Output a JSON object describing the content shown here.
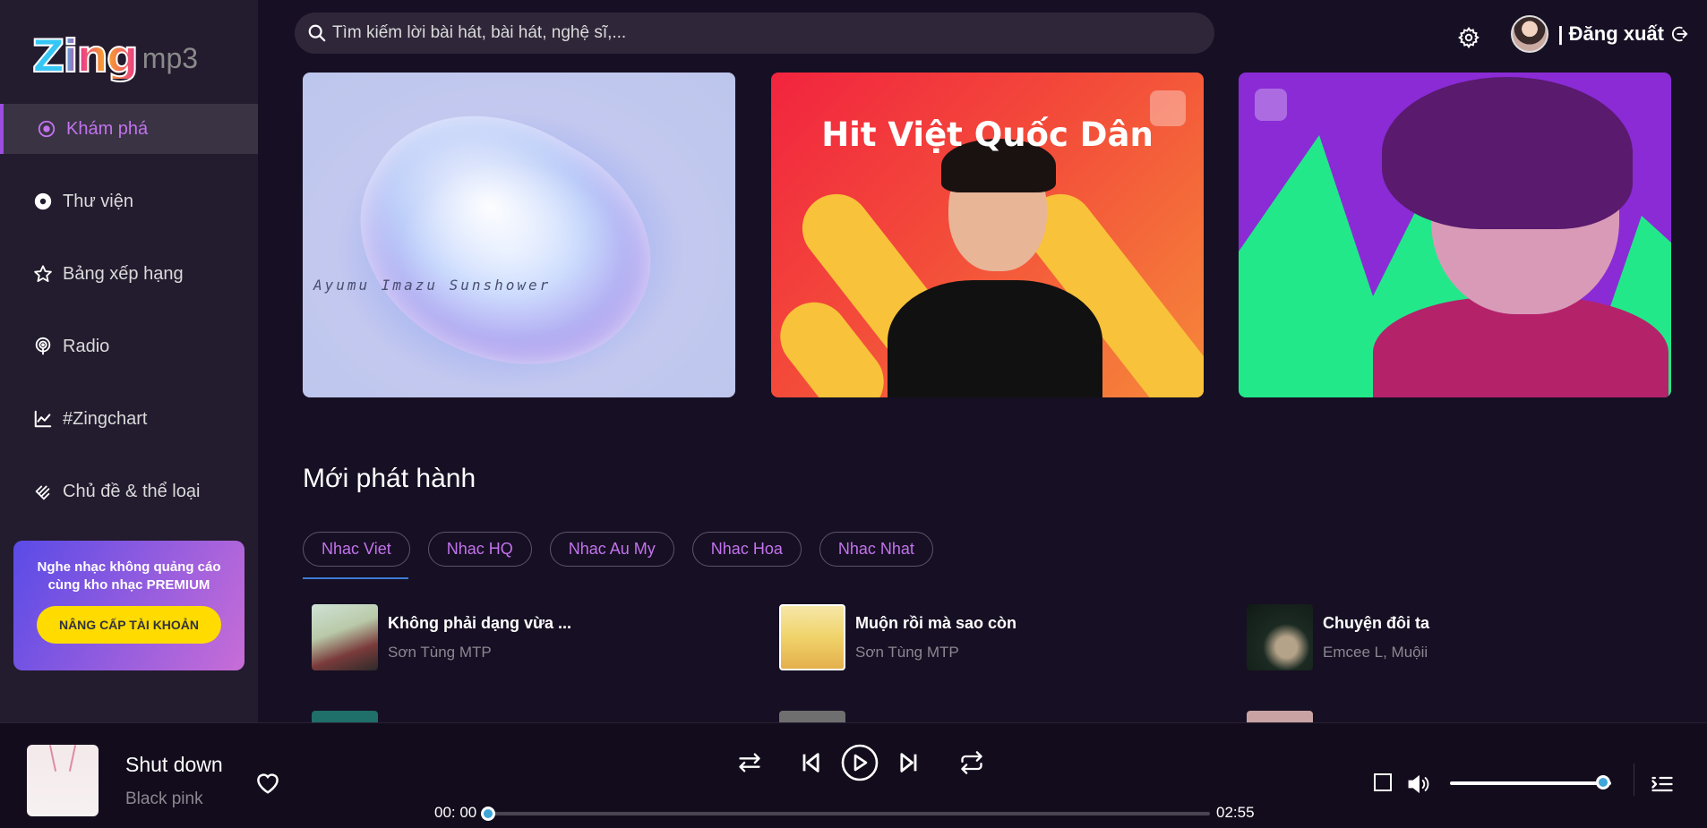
{
  "logo": {
    "brand": "Zing",
    "suffix": "mp3"
  },
  "sidebar": {
    "items": [
      {
        "label": "Khám phá",
        "icon": "disc-icon",
        "active": true
      },
      {
        "label": "Thư viện",
        "icon": "library-icon",
        "active": false
      },
      {
        "label": "Bảng xếp hạng",
        "icon": "star-icon",
        "active": false
      },
      {
        "label": "Radio",
        "icon": "radio-icon",
        "active": false
      },
      {
        "label": "#Zingchart",
        "icon": "chart-icon",
        "active": false
      },
      {
        "label": "Chủ đề & thể loại",
        "icon": "category-icon",
        "active": false
      }
    ],
    "promo": {
      "text": "Nghe nhạc không quảng cáo cùng kho nhạc PREMIUM",
      "button": "NÂNG CẤP TÀI KHOẢN"
    }
  },
  "header": {
    "search_placeholder": "Tìm kiếm lời bài hát, bài hát, nghệ sĩ,...",
    "logout_label": "| Đăng xuất"
  },
  "banners": [
    {
      "name": "banner-sunshower",
      "text": "Ayumu Imazu  Sunshower"
    },
    {
      "name": "banner-hit-viet",
      "text": "Hit Việt Quốc Dân"
    },
    {
      "name": "banner-purple-artist",
      "text": ""
    }
  ],
  "new_releases": {
    "title": "Mới phát hành",
    "tabs": [
      "Nhac Viet",
      "Nhac HQ",
      "Nhac Au My",
      "Nhac Hoa",
      "Nhac Nhat"
    ],
    "active_tab": "Nhac Viet",
    "songs": [
      {
        "title": "Không phải dạng vừa ...",
        "artist": "Sơn Tùng MTP"
      },
      {
        "title": "Muộn rồi mà sao còn",
        "artist": "Sơn Tùng MTP"
      },
      {
        "title": "Chuyện đôi ta",
        "artist": "Emcee L, Muộii"
      }
    ]
  },
  "player": {
    "title": "Shut down",
    "artist": "Black pink",
    "current_time": "00: 00",
    "duration": "02:55",
    "progress": 0,
    "volume": 0.95
  },
  "colors": {
    "accent": "#c273ed",
    "background": "#170f23",
    "sidebar": "#231b2e",
    "promo_button": "#ffdb00"
  }
}
